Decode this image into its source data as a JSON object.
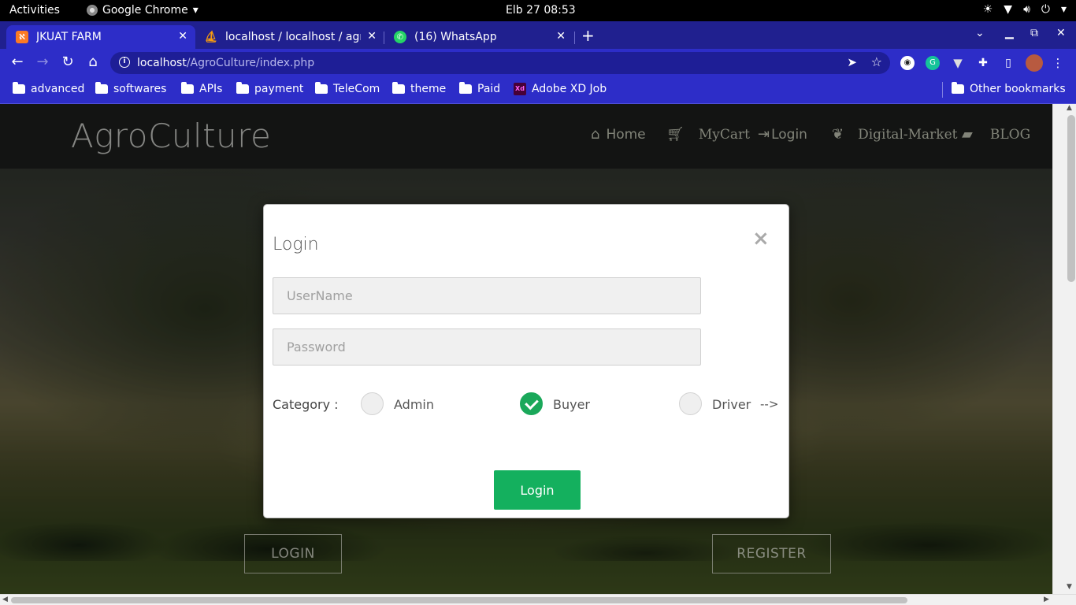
{
  "system_bar": {
    "activities": "Activities",
    "app_name": "Google Chrome",
    "datetime": "Elb 27  08:53"
  },
  "tabs": [
    {
      "title": "JKUAT FARM",
      "active": true,
      "favicon": "xampp-icon",
      "favicon_color": "#fb7a24"
    },
    {
      "title": "localhost / localhost / agr",
      "active": false,
      "favicon": "phpmyadmin-icon",
      "favicon_color": "#f89c0e"
    },
    {
      "title": "(16) WhatsApp",
      "active": false,
      "favicon": "whatsapp-icon",
      "favicon_color": "#25d366"
    }
  ],
  "address_bar": {
    "host": "localhost",
    "path": "/AgroCulture/index.php"
  },
  "bookmarks": [
    "advanced",
    "softwares",
    "APIs",
    "payment",
    "TeleCom",
    "theme",
    "Paid",
    "Adobe XD Job"
  ],
  "other_bookmarks": "Other bookmarks",
  "site": {
    "brand": "AgroCulture",
    "nav": [
      {
        "label": "Home",
        "icon": "home-icon"
      },
      {
        "label": "MyCart",
        "icon": "cart-icon"
      },
      {
        "label": "Login",
        "icon": "login-icon"
      },
      {
        "label": "Digital-Market",
        "icon": "leaf-icon"
      },
      {
        "label": "BLOG",
        "icon": "comment-icon"
      }
    ],
    "hero_buttons": {
      "login": "LOGIN",
      "register": "REGISTER"
    }
  },
  "modal": {
    "title": "Login",
    "close": "×",
    "username_placeholder": "UserName",
    "password_placeholder": "Password",
    "category_label": "Category :",
    "options": [
      {
        "label": "Admin",
        "checked": false
      },
      {
        "label": "Buyer",
        "checked": true
      },
      {
        "label": "Driver",
        "checked": false
      }
    ],
    "stray_text": "-->",
    "submit": "Login"
  },
  "colors": {
    "chrome_tabstrip": "#20208f",
    "chrome_toolbar": "#2d2dc8",
    "site_header": "#1b1c1b",
    "accent_green": "#14b05e"
  }
}
